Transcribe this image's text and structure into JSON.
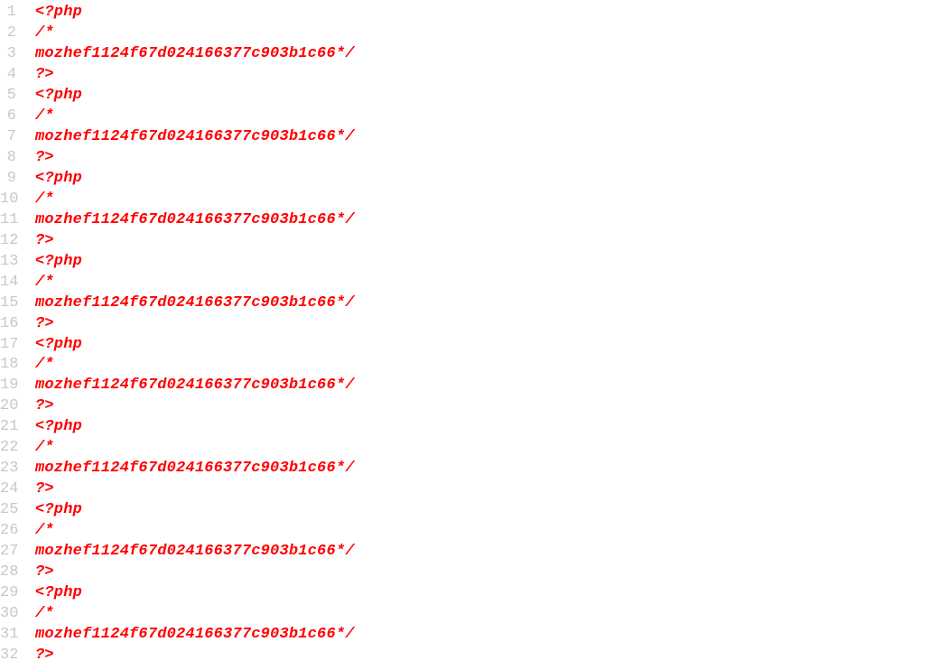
{
  "editor": {
    "colors": {
      "code": "#ff0000",
      "line_number": "#c8c8c8",
      "background": "#ffffff"
    },
    "lines": [
      "<?php",
      "/*",
      "mozhef1124f67d024166377c903b1c66*/",
      "?>",
      "<?php",
      "/*",
      "mozhef1124f67d024166377c903b1c66*/",
      "?>",
      "<?php",
      "/*",
      "mozhef1124f67d024166377c903b1c66*/",
      "?>",
      "<?php",
      "/*",
      "mozhef1124f67d024166377c903b1c66*/",
      "?>",
      "<?php",
      "/*",
      "mozhef1124f67d024166377c903b1c66*/",
      "?>",
      "<?php",
      "/*",
      "mozhef1124f67d024166377c903b1c66*/",
      "?>",
      "<?php",
      "/*",
      "mozhef1124f67d024166377c903b1c66*/",
      "?>",
      "<?php",
      "/*",
      "mozhef1124f67d024166377c903b1c66*/",
      "?>"
    ]
  }
}
